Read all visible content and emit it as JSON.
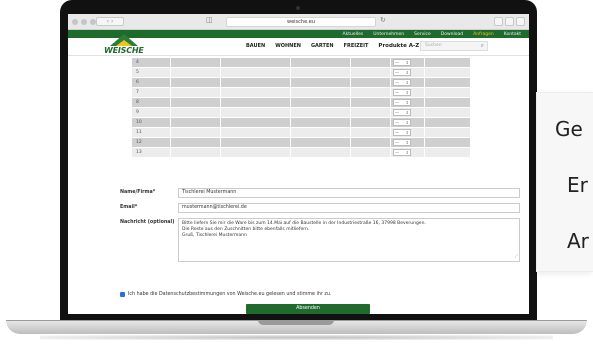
{
  "browser": {
    "url": "weische.eu"
  },
  "site": {
    "logo_text": "WEISCHE",
    "top_links": [
      {
        "label": "Aktuelles",
        "active": false
      },
      {
        "label": "Unternehmen",
        "active": false
      },
      {
        "label": "Service",
        "active": false
      },
      {
        "label": "Download",
        "active": false
      },
      {
        "label": "Anfragen",
        "active": true
      },
      {
        "label": "Kontakt",
        "active": false
      }
    ],
    "main_nav": [
      "BAUEN",
      "WOHNEN",
      "GARTEN",
      "FREIZEIT",
      "Produkte A-Z"
    ],
    "search_placeholder": "Suchen"
  },
  "table": {
    "rows": [
      {
        "num": "4",
        "qty": "—"
      },
      {
        "num": "5",
        "qty": "—"
      },
      {
        "num": "6",
        "qty": "—"
      },
      {
        "num": "7",
        "qty": "—"
      },
      {
        "num": "8",
        "qty": "—"
      },
      {
        "num": "9",
        "qty": "—"
      },
      {
        "num": "10",
        "qty": "—"
      },
      {
        "num": "11",
        "qty": "—"
      },
      {
        "num": "12",
        "qty": "—"
      },
      {
        "num": "13",
        "qty": "—"
      }
    ]
  },
  "form": {
    "name_label": "Name/Firma*",
    "name_value": "Tischlerei Mustermann",
    "email_label": "Email*",
    "email_value": "mustermann@tischlerei.de",
    "message_label": "Nachricht (optional)",
    "message_lines": [
      "Bitte liefern Sie mir die Ware bis zum 14.Mai auf die Baustelle in der Industriestraße 16, 37998 Beverungen.",
      "Die Reste aus den Zuschnitten bitte ebenfalls mitliefern.",
      "Gruß, Tischlerei Mustermann"
    ],
    "consent_text": "Ich habe die Datenschutzbestimmungen von Weische.eu gelesen und stimme ihr zu.",
    "submit_label": "Absenden"
  },
  "card": {
    "lines": [
      "Ge",
      "Er",
      "Ar"
    ]
  },
  "colors": {
    "brand_green": "#1f6b2e",
    "accent_yellow": "#f0c419"
  }
}
